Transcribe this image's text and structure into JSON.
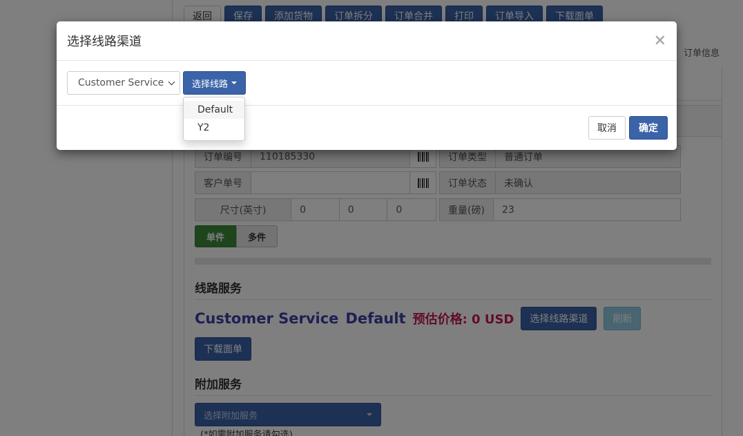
{
  "modal": {
    "title": "选择线路渠道",
    "close_glyph": "×",
    "route_select_value": "Customer Service",
    "line_button_label": "选择线路",
    "line_options": [
      "Default",
      "Y2"
    ],
    "cancel_label": "取消",
    "confirm_label": "确定"
  },
  "toolbar": {
    "items": [
      "返回",
      "保存",
      "添加货物",
      "订单拆分",
      "订单合并",
      "打印",
      "订单导入",
      "下载面单"
    ]
  },
  "tabs": {
    "order_info": "订单信息"
  },
  "order": {
    "order_no_label": "订单编号",
    "order_no": "110185330",
    "order_type_label": "订单类型",
    "order_type": "普通订单",
    "customer_no_label": "客户单号",
    "customer_no": "",
    "order_status_label": "订单状态",
    "order_status": "未确认",
    "size_label": "尺寸(英寸)",
    "size_values": [
      "0",
      "0",
      "0"
    ],
    "weight_label": "重量(磅)",
    "weight": "23",
    "package_single": "单件",
    "package_multi": "多件"
  },
  "route_service": {
    "title": "线路服务",
    "route_name": "Customer Service",
    "line_name": "Default",
    "price_text": "预估价格: 0 USD",
    "select_button": "选择线路渠道",
    "refresh_button": "刷新",
    "download_button": "下载面单"
  },
  "addon_service": {
    "title": "附加服务",
    "select_placeholder": "选择附加服务",
    "note": "(*如需附加服务请勾选)"
  },
  "colors": {
    "primary": "#3b63a8",
    "success": "#3f8a3a",
    "route_text": "#3c3ea6",
    "price_text": "#c2185b",
    "info": "#7ec3dd"
  }
}
